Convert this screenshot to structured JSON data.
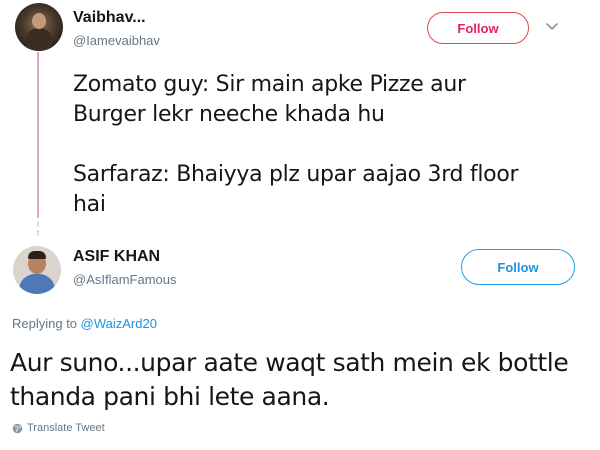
{
  "original_tweet": {
    "display_name": "Vaibhav...",
    "handle": "@Iamevaibhav",
    "follow_label": "Follow",
    "text": "Zomato guy: Sir main apke Pizze aur\nBurger lekr neeche khada hu\n\nSarfaraz: Bhaiyya plz upar aajao 3rd floor\nhai"
  },
  "reply_tweet": {
    "display_name": "ASIF KHAN",
    "handle": "@AsIflamFamous",
    "follow_label": "Follow",
    "replying_prefix": "Replying to ",
    "replying_to": "@WaizArd20",
    "text": "Aur suno...upar aate waqt sath mein ek bottle\nthanda pani bhi lete aana.",
    "translate_label": "Translate Tweet"
  },
  "colors": {
    "thread_line": "#e2a8c3",
    "follow_border": "#e24a4a",
    "link_blue": "#1b95e0",
    "secondary_text": "#657786"
  },
  "icons": {
    "more_menu": "chevron-down-icon",
    "translate": "globe-icon"
  }
}
